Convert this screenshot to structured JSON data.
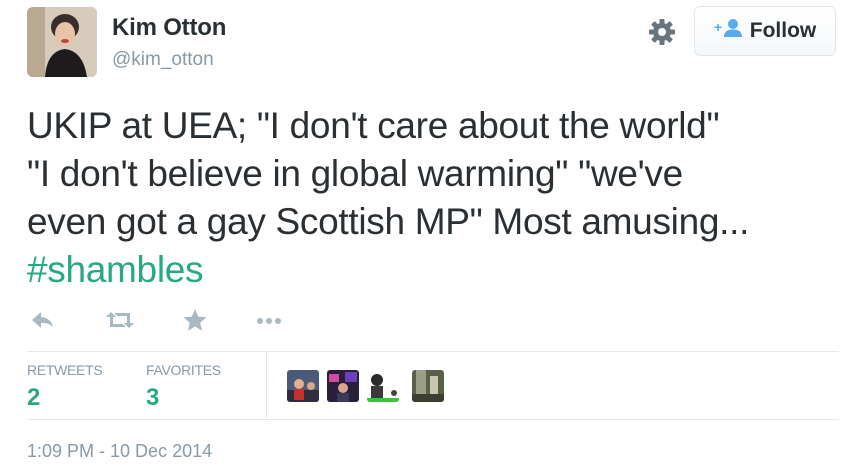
{
  "author": {
    "name": "Kim Otton",
    "handle": "@kim_otton"
  },
  "follow_button": {
    "label": "Follow"
  },
  "tweet": {
    "lines": [
      "UKIP at UEA; \"I don't care about the world\"",
      "\"I don't believe in global warming\" \"we've",
      "even got a gay Scottish MP\" Most amusing..."
    ],
    "hashtag": "#shambles"
  },
  "actions": [
    "reply-icon",
    "retweet-icon",
    "favorite-icon",
    "more-icon"
  ],
  "stats": {
    "retweets_label": "RETWEETS",
    "retweets_count": "2",
    "favorites_label": "FAVORITES",
    "favorites_count": "3"
  },
  "favoriters_count_shown": 4,
  "timestamp": "1:09 PM - 10 Dec 2014",
  "colors": {
    "accent": "#29a983",
    "text": "#292f33",
    "muted": "#8899a6",
    "border": "#e1e8ed"
  }
}
